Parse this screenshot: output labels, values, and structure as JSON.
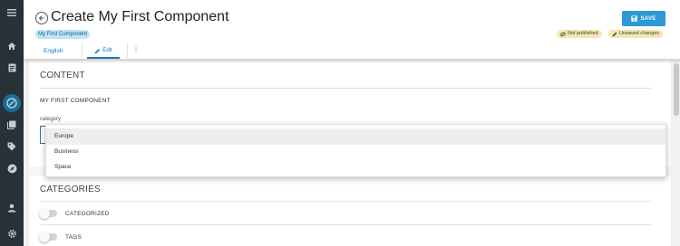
{
  "header": {
    "title": "Create My First Component",
    "name_chip": "My First Component",
    "save_label": "SAVE",
    "status_not_published": "Not published",
    "status_unsaved": "Unsaved changes"
  },
  "tabs": {
    "language": "English",
    "edit": "Edit",
    "more": "⋮"
  },
  "content": {
    "section_title": "CONTENT",
    "field_label": "MY FIRST COMPONENT",
    "category_label": "category",
    "category_options": [
      "Europe",
      "Business",
      "Space"
    ],
    "highlighted_option": "Europe"
  },
  "categories": {
    "section_title": "CATEGORIES",
    "toggles": [
      {
        "label": "CATEGORIZED",
        "on": false
      },
      {
        "label": "TAGS",
        "on": false
      }
    ]
  },
  "colors": {
    "sidebar": "#263238",
    "accent": "#2d98d6",
    "chip": "#bfe3f7",
    "status_pill": "#f2e7b5"
  },
  "icons": {
    "sidebar": [
      "menu-icon",
      "home-icon",
      "document-icon",
      "component-icon",
      "library-icon",
      "tag-icon",
      "compass-icon",
      "user-icon",
      "settings-icon"
    ]
  }
}
